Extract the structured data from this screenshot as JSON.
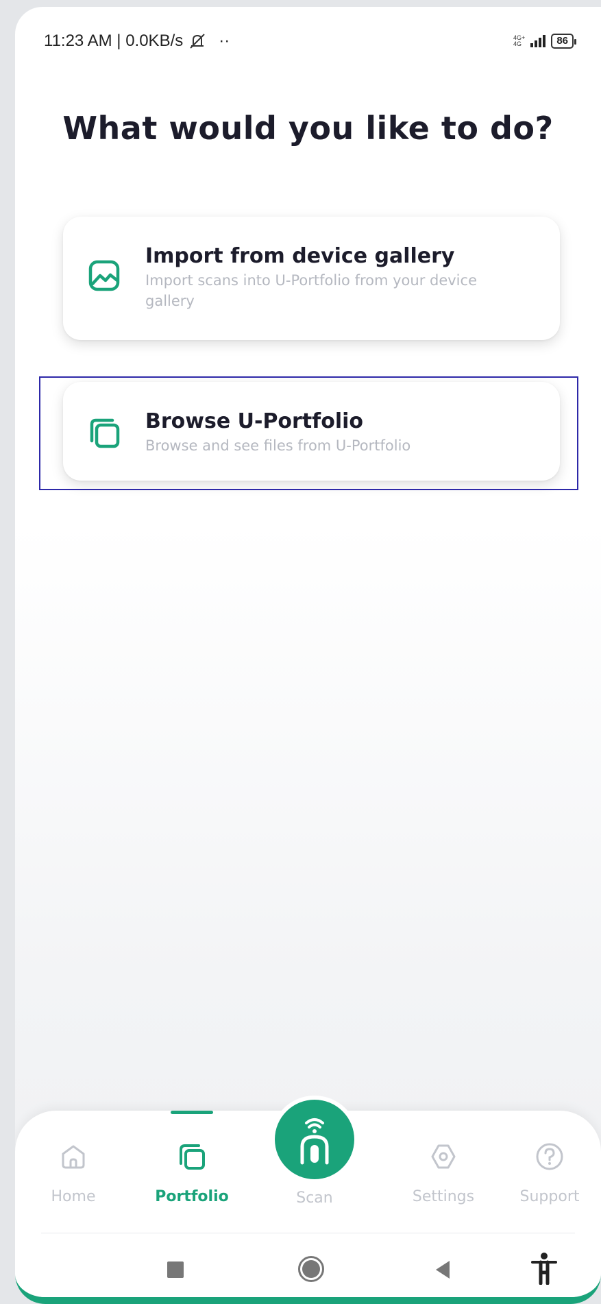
{
  "status_bar": {
    "time_speed": "11:23 AM | 0.0KB/s",
    "dots": "··",
    "network_top": "4G+",
    "network_bottom": "4G",
    "battery": "86"
  },
  "page": {
    "title": "What would you like to do?"
  },
  "options": [
    {
      "title": "Import from device gallery",
      "subtitle": "Import scans into U-Portfolio from your device gallery",
      "icon": "gallery-icon"
    },
    {
      "title": "Browse U-Portfolio",
      "subtitle": "Browse and see files from U-Portfolio",
      "icon": "folders-icon"
    }
  ],
  "bottom_nav": {
    "items": [
      {
        "label": "Home",
        "icon": "home-icon",
        "active": false
      },
      {
        "label": "Portfolio",
        "icon": "portfolio-icon",
        "active": true
      },
      {
        "label": "Scan",
        "icon": "scan-icon",
        "active": false
      },
      {
        "label": "Settings",
        "icon": "settings-icon",
        "active": false
      },
      {
        "label": "Support",
        "icon": "help-icon",
        "active": false
      }
    ]
  },
  "colors": {
    "accent": "#1aa37a",
    "title_text": "#1c1c2b",
    "muted_text": "#b5b8c0",
    "highlight_border": "#2d28a8"
  }
}
